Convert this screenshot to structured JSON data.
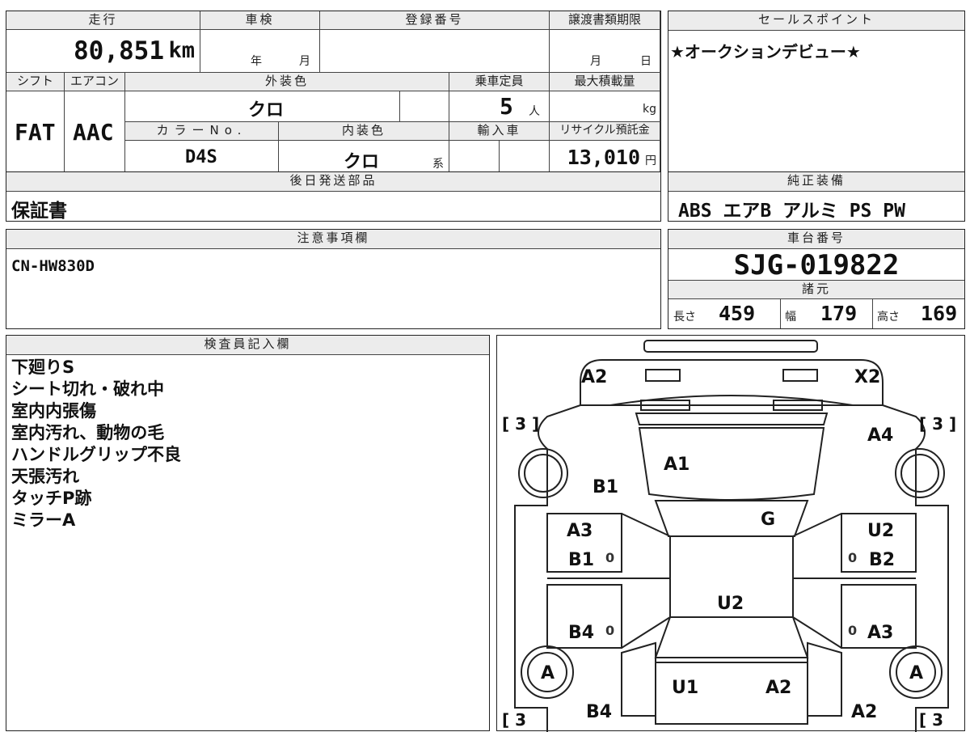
{
  "top_table": {
    "mileage_label": "走行",
    "mileage": "80,851",
    "mileage_unit": "km",
    "inspection_label": "車検",
    "year_unit": "年",
    "month_unit": "月",
    "registration_label": "登録番号",
    "transfer_deadline_label": "譲渡書類期限",
    "deadline_month": "月",
    "deadline_day": "日",
    "shift_label": "シフト",
    "shift": "FAT",
    "aircon_label": "エアコン",
    "aircon": "AAC",
    "exterior_color_label": "外装色",
    "exterior_color": "クロ",
    "capacity_label": "乗車定員",
    "capacity": "5",
    "capacity_unit": "人",
    "max_load_label": "最大積載量",
    "max_load_unit": "kg",
    "color_no_label": "カラーNo.",
    "color_no": "D4S",
    "interior_color_label": "内装色",
    "interior_color": "クロ",
    "interior_suffix": "系",
    "import_label": "輸入車",
    "recycle_label": "リサイクル預託金",
    "recycle_fee": "13,010",
    "recycle_unit": "円"
  },
  "selling_points": {
    "label": "セールスポイント",
    "text": "★オークションデビュー★"
  },
  "post_delivery": {
    "label": "後日発送部品",
    "text": "保証書"
  },
  "equipment": {
    "label": "純正装備",
    "items": "ABS エアB アルミ PS PW"
  },
  "notes_section": {
    "label": "注意事項欄",
    "text": "CN-HW830D"
  },
  "chassis": {
    "label": "車台番号",
    "number": "SJG-019822"
  },
  "specs": {
    "label": "諸元",
    "length_label": "長さ",
    "length": "459",
    "width_label": "幅",
    "width": "179",
    "height_label": "高さ",
    "height": "169"
  },
  "inspector": {
    "label": "検査員記入欄",
    "lines": [
      "下廻りS",
      "シート切れ・破れ中",
      "室内内張傷",
      "室内汚れ、動物の毛",
      "ハンドルグリップ不良",
      "天張汚れ",
      "タッチP跡",
      "ミラーA"
    ]
  },
  "diagram": {
    "marks": {
      "a2_tl": "A2",
      "x2_tr": "X2",
      "a4": "A4",
      "a1": "A1",
      "b1_left": "B1",
      "g": "G",
      "a3_left": "A3",
      "b1_door": "B1",
      "u2_right": "U2",
      "b2": "B2",
      "u2_center": "U2",
      "b4_left": "B4",
      "a3_right": "A3",
      "a_left": "A",
      "a_right": "A",
      "u1": "U1",
      "a2_bottom": "A2",
      "b4_bottom": "B4",
      "a2_br": "A2",
      "tire_tl": "[ 3 ]",
      "tire_tr": "[ 3 ]",
      "tire_bl": "[ 3",
      "tire_br": "[ 3",
      "zero_1": "0",
      "zero_2": "0",
      "zero_3": "0",
      "zero_4": "0"
    }
  }
}
